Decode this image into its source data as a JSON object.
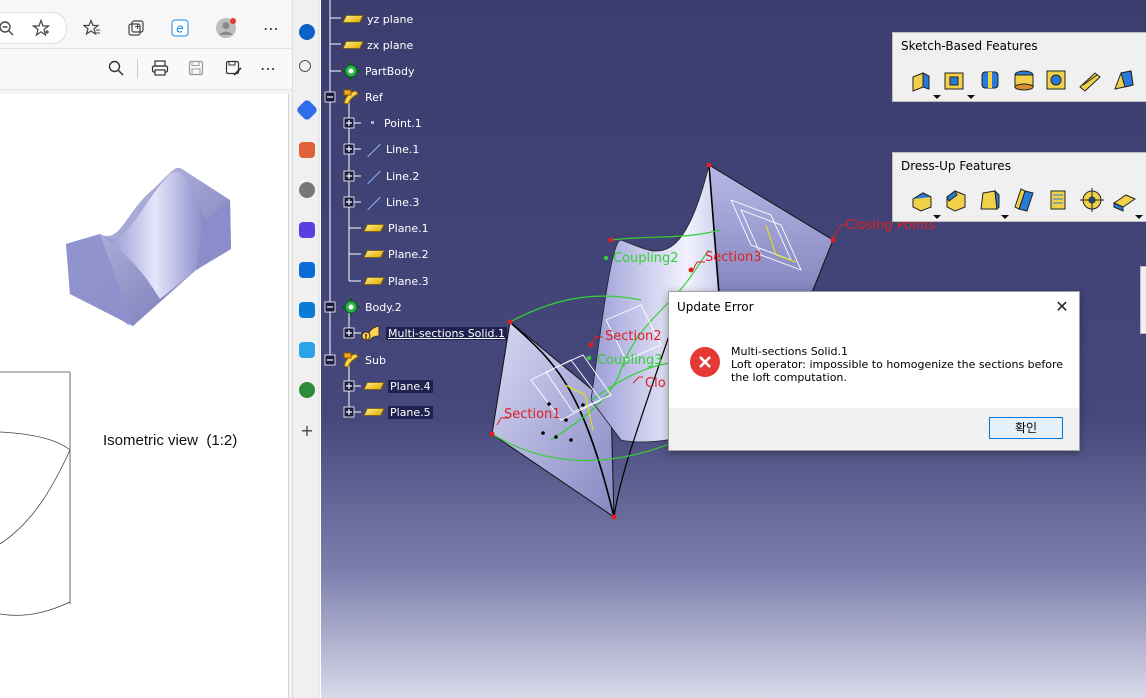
{
  "pdf_viewer": {
    "iso_caption": "Isometric view  (1:2)"
  },
  "catia": {
    "tree": [
      {
        "label": "yz plane",
        "icon": "plane-icon"
      },
      {
        "label": "zx plane",
        "icon": "plane-icon"
      },
      {
        "label": "PartBody",
        "icon": "gear-icon"
      },
      {
        "label": "Ref",
        "icon": "geometrical-set-icon"
      },
      {
        "label": "Point.1",
        "icon": "point-icon"
      },
      {
        "label": "Line.1",
        "icon": "line-icon"
      },
      {
        "label": "Line.2",
        "icon": "line-icon"
      },
      {
        "label": "Line.3",
        "icon": "line-icon"
      },
      {
        "label": "Plane.1",
        "icon": "plane-icon"
      },
      {
        "label": "Plane.2",
        "icon": "plane-icon"
      },
      {
        "label": "Plane.3",
        "icon": "plane-icon"
      },
      {
        "label": "Body.2",
        "icon": "gear-icon"
      },
      {
        "label": "Multi-sections Solid.1",
        "icon": "loft-warning-icon"
      },
      {
        "label": "Sub",
        "icon": "geometrical-set-icon"
      },
      {
        "label": "Plane.4",
        "icon": "plane-icon"
      },
      {
        "label": "Plane.5",
        "icon": "plane-icon"
      }
    ],
    "toolbars": {
      "sketch_based": "Sketch-Based Features",
      "dress_up": "Dress-Up Features"
    },
    "labels_3d": {
      "section1": "Section1",
      "section2": "Section2",
      "section3": "Section3",
      "coupling2": "Coupling2",
      "coupling3": "Coupling3",
      "closing_points": "Closing Points",
      "closing_partial": "Clo"
    },
    "dialog": {
      "title": "Update Error",
      "close_glyph": "✕",
      "feature": "Multi-sections Solid.1",
      "message": "Loft operator: impossible to homogenize the sections before the loft computation.",
      "ok_label": "확인"
    }
  },
  "colors": {
    "workspace_top": "#3b3d6f",
    "label_red": "#e02020",
    "label_green": "#30d030",
    "error_red": "#e53935"
  }
}
